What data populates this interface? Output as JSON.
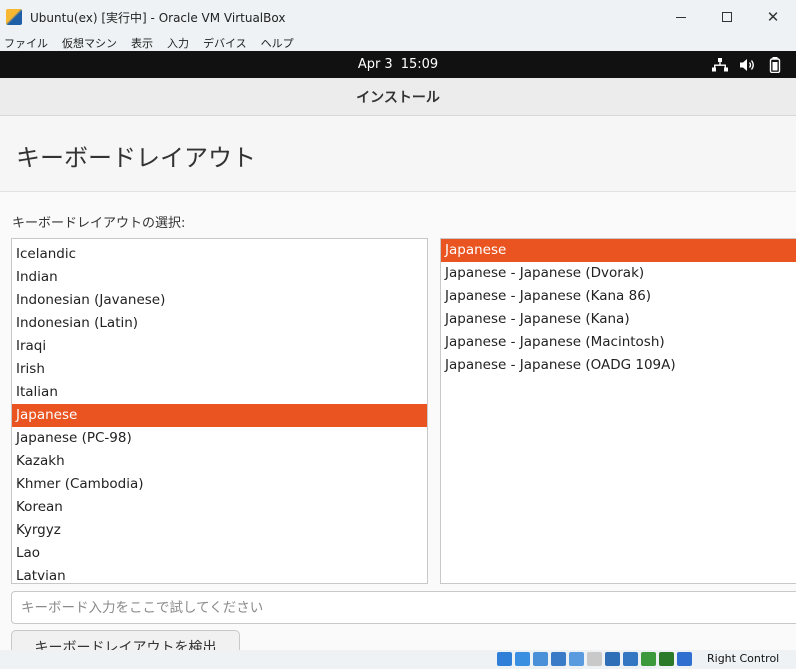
{
  "vbox": {
    "title": "Ubuntu(ex) [実行中] - Oracle VM VirtualBox",
    "menu": [
      "ファイル",
      "仮想マシン",
      "表示",
      "入力",
      "デバイス",
      "ヘルプ"
    ],
    "host_key": "Right Control",
    "status_icons": [
      {
        "name": "hdd-icon",
        "color": "#2f7fd8"
      },
      {
        "name": "optical-disc-icon",
        "color": "#3b8fe0"
      },
      {
        "name": "audio-icon",
        "color": "#4a90d9"
      },
      {
        "name": "network-icon",
        "color": "#3a7bc8"
      },
      {
        "name": "usb-icon",
        "color": "#5a9be0"
      },
      {
        "name": "shared-folders-icon",
        "color": "#c9c9c9"
      },
      {
        "name": "display-icon",
        "color": "#2f6fb8"
      },
      {
        "name": "video-capture-icon",
        "color": "#3377c2"
      },
      {
        "name": "mouse-integration-icon",
        "color": "#3c9a3c"
      },
      {
        "name": "guest-additions-icon",
        "color": "#2a7a2a"
      },
      {
        "name": "keyboard-capture-icon",
        "color": "#2f6fd0"
      }
    ]
  },
  "gnome": {
    "date": "Apr 3",
    "time": "15:09"
  },
  "installer": {
    "header_title": "インストール",
    "page_title": "キーボードレイアウト",
    "select_label": "キーボードレイアウトの選択:",
    "accent_color": "#e95420",
    "layouts": [
      {
        "label": "Icelandic",
        "selected": false
      },
      {
        "label": "Indian",
        "selected": false
      },
      {
        "label": "Indonesian (Javanese)",
        "selected": false
      },
      {
        "label": "Indonesian (Latin)",
        "selected": false
      },
      {
        "label": "Iraqi",
        "selected": false
      },
      {
        "label": "Irish",
        "selected": false
      },
      {
        "label": "Italian",
        "selected": false
      },
      {
        "label": "Japanese",
        "selected": true
      },
      {
        "label": "Japanese (PC-98)",
        "selected": false
      },
      {
        "label": "Kazakh",
        "selected": false
      },
      {
        "label": "Khmer (Cambodia)",
        "selected": false
      },
      {
        "label": "Korean",
        "selected": false
      },
      {
        "label": "Kyrgyz",
        "selected": false
      },
      {
        "label": "Lao",
        "selected": false
      },
      {
        "label": "Latvian",
        "selected": false
      }
    ],
    "variants": [
      {
        "label": "Japanese",
        "selected": true
      },
      {
        "label": "Japanese - Japanese (Dvorak)",
        "selected": false
      },
      {
        "label": "Japanese - Japanese (Kana 86)",
        "selected": false
      },
      {
        "label": "Japanese - Japanese (Kana)",
        "selected": false
      },
      {
        "label": "Japanese - Japanese (Macintosh)",
        "selected": false
      },
      {
        "label": "Japanese - Japanese (OADG 109A)",
        "selected": false
      }
    ],
    "test_placeholder": "キーボード入力をここで試してください",
    "test_value": "",
    "detect_label": "キーボードレイアウトを検出"
  }
}
